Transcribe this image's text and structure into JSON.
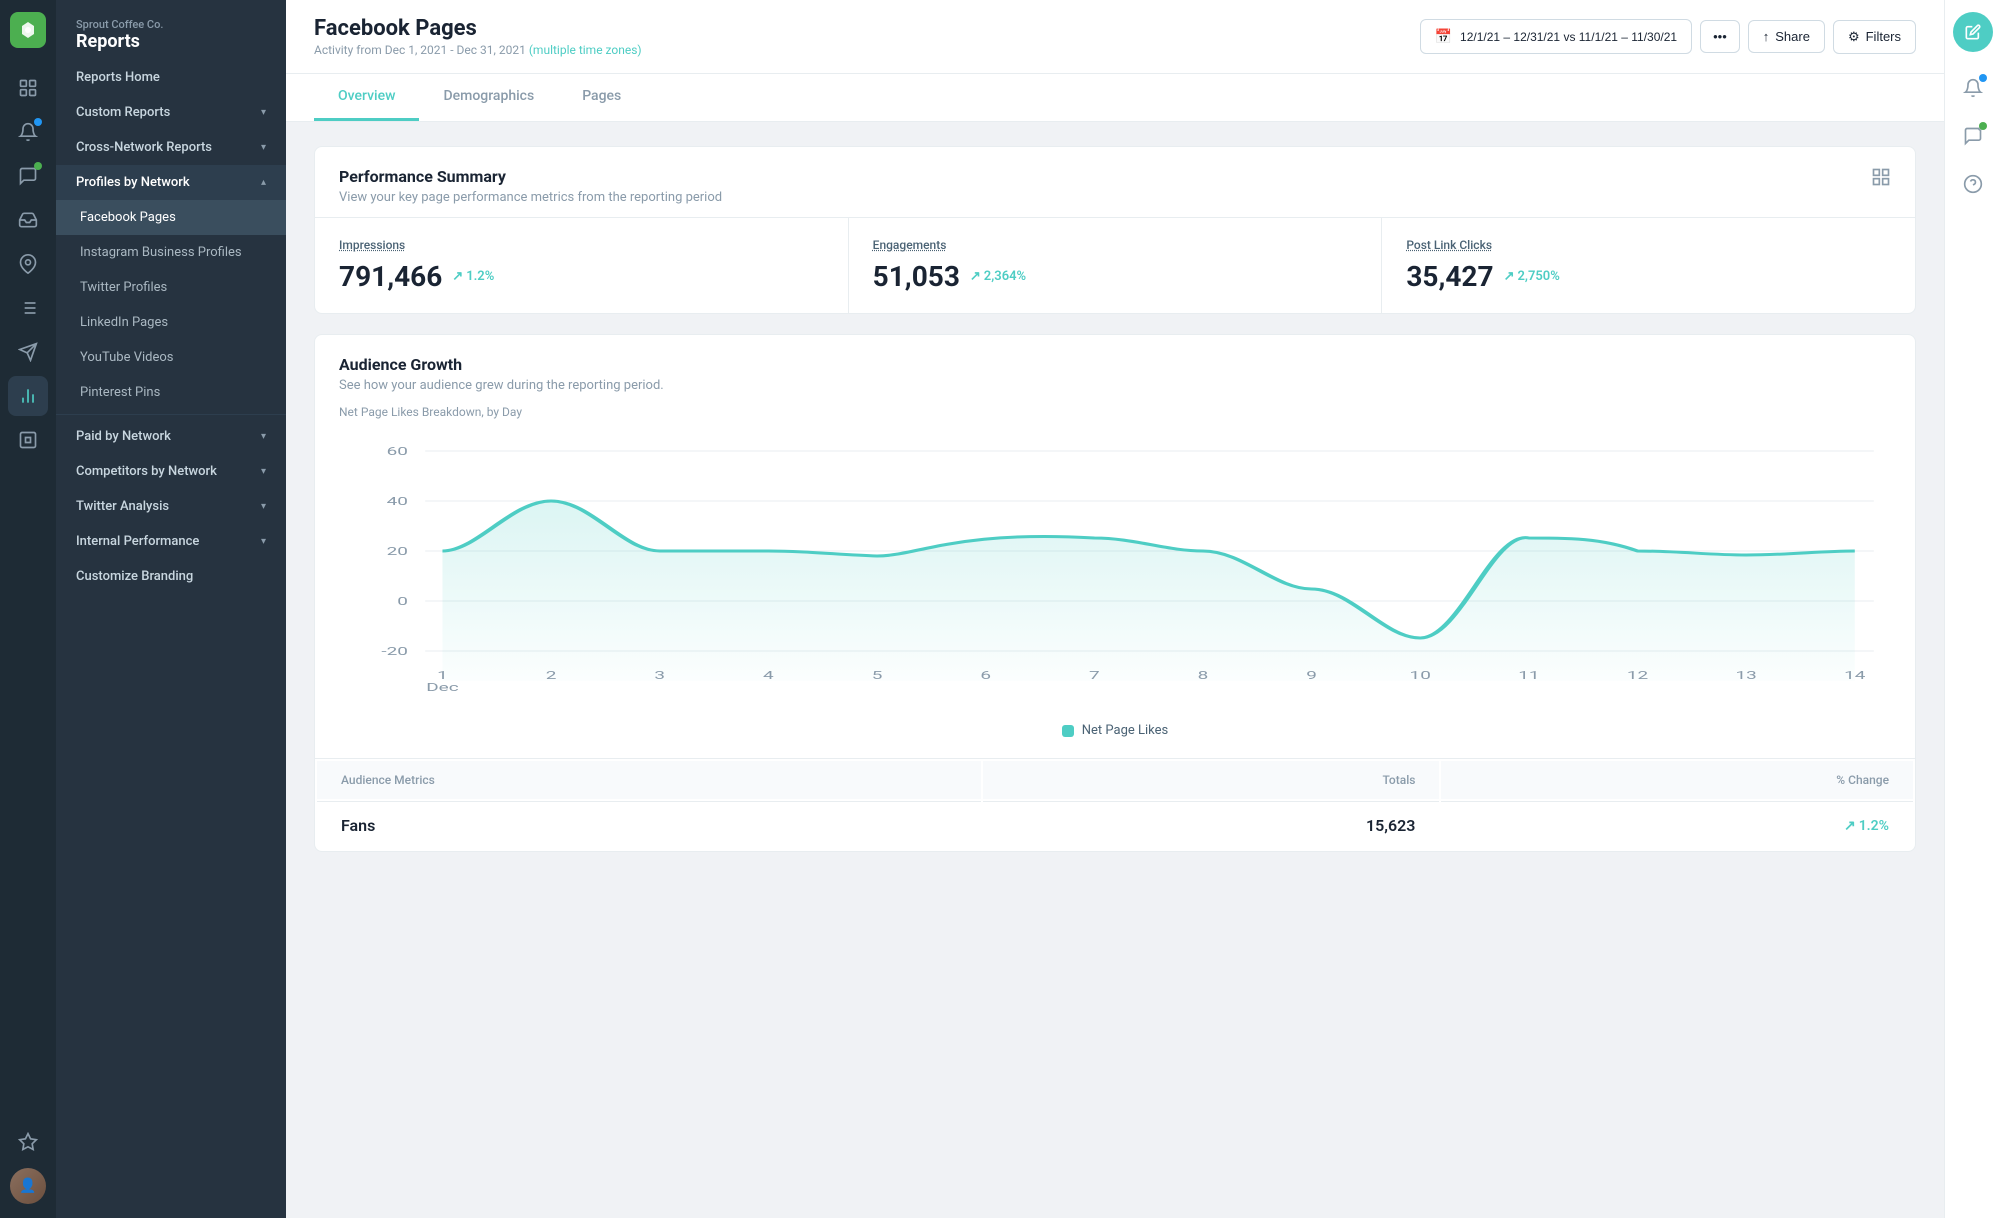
{
  "brand": {
    "company": "Sprout Coffee Co.",
    "section": "Reports"
  },
  "nav": {
    "top_items": [
      {
        "label": "Reports Home",
        "icon": "🏠",
        "active": false
      },
      {
        "label": "Custom Reports",
        "icon": "📄",
        "has_arrow": true,
        "active": false
      },
      {
        "label": "Cross-Network Reports",
        "icon": "🌐",
        "has_arrow": true,
        "active": false
      },
      {
        "label": "Profiles by Network",
        "icon": "👤",
        "has_arrow": true,
        "active": true
      }
    ],
    "profiles_sub": [
      {
        "label": "Facebook Pages",
        "active": true
      },
      {
        "label": "Instagram Business Profiles",
        "active": false
      },
      {
        "label": "Twitter Profiles",
        "active": false
      },
      {
        "label": "LinkedIn Pages",
        "active": false
      },
      {
        "label": "YouTube Videos",
        "active": false
      },
      {
        "label": "Pinterest Pins",
        "active": false
      }
    ],
    "bottom_sections": [
      {
        "label": "Paid by Network",
        "has_arrow": true
      },
      {
        "label": "Competitors by Network",
        "has_arrow": true
      },
      {
        "label": "Twitter Analysis",
        "has_arrow": true
      },
      {
        "label": "Internal Performance",
        "has_arrow": true
      },
      {
        "label": "Customize Branding",
        "has_arrow": false
      }
    ]
  },
  "header": {
    "title": "Facebook Pages",
    "subtitle": "Activity from Dec 1, 2021 - Dec 31, 2021",
    "timezone_text": "multiple time zones",
    "date_range": "12/1/21 – 12/31/21 vs 11/1/21 – 11/30/21",
    "share_label": "Share",
    "filters_label": "Filters"
  },
  "tabs": [
    {
      "label": "Overview",
      "active": true
    },
    {
      "label": "Demographics",
      "active": false
    },
    {
      "label": "Pages",
      "active": false
    }
  ],
  "performance_summary": {
    "title": "Performance Summary",
    "subtitle": "View your key page performance metrics from the reporting period",
    "metrics": [
      {
        "label": "Impressions",
        "value": "791,466",
        "change": "1.2%",
        "positive": true
      },
      {
        "label": "Engagements",
        "value": "51,053",
        "change": "2,364%",
        "positive": true
      },
      {
        "label": "Post Link Clicks",
        "value": "35,427",
        "change": "2,750%",
        "positive": true
      }
    ]
  },
  "audience_growth": {
    "title": "Audience Growth",
    "subtitle": "See how your audience grew during the reporting period.",
    "chart_label": "Net Page Likes Breakdown, by Day",
    "legend": "Net Page Likes",
    "x_labels": [
      "1\nDec",
      "2",
      "3",
      "4",
      "5",
      "6",
      "7",
      "8",
      "9",
      "10",
      "11",
      "12",
      "13",
      "14"
    ],
    "y_labels": [
      "60",
      "40",
      "20",
      "0",
      "-20"
    ],
    "data_points": [
      20,
      40,
      18,
      20,
      18,
      17,
      25,
      18,
      5,
      -15,
      22,
      20,
      18,
      20
    ]
  },
  "audience_metrics": {
    "title": "Audience Metrics",
    "columns": [
      "Totals",
      "% Change"
    ],
    "rows": [
      {
        "label": "Fans",
        "totals": "15,623",
        "change": "1.2%",
        "positive": true
      }
    ]
  },
  "icon_rail": {
    "icons": [
      {
        "name": "home-icon",
        "symbol": "⊞",
        "active": false
      },
      {
        "name": "notification-icon",
        "symbol": "🔔",
        "active": false,
        "badge": true
      },
      {
        "name": "message-icon",
        "symbol": "💬",
        "active": false,
        "badge_green": true
      },
      {
        "name": "inbox-icon",
        "symbol": "📥",
        "active": false
      },
      {
        "name": "pin-icon",
        "symbol": "📌",
        "active": false
      },
      {
        "name": "list-icon",
        "symbol": "☰",
        "active": false
      },
      {
        "name": "send-icon",
        "symbol": "✈",
        "active": false
      },
      {
        "name": "analytics-icon",
        "symbol": "📊",
        "active": true
      },
      {
        "name": "bot-icon",
        "symbol": "🤖",
        "active": false
      },
      {
        "name": "star-icon",
        "symbol": "⭐",
        "active": false
      }
    ]
  },
  "right_sidebar": {
    "icons": [
      {
        "name": "edit-icon",
        "symbol": "✏",
        "color": "#4ecdc4"
      },
      {
        "name": "alert-icon",
        "symbol": "🔔",
        "badge": true
      },
      {
        "name": "chat-icon",
        "symbol": "💬",
        "badge_green": true
      },
      {
        "name": "help-icon",
        "symbol": "?"
      }
    ]
  }
}
